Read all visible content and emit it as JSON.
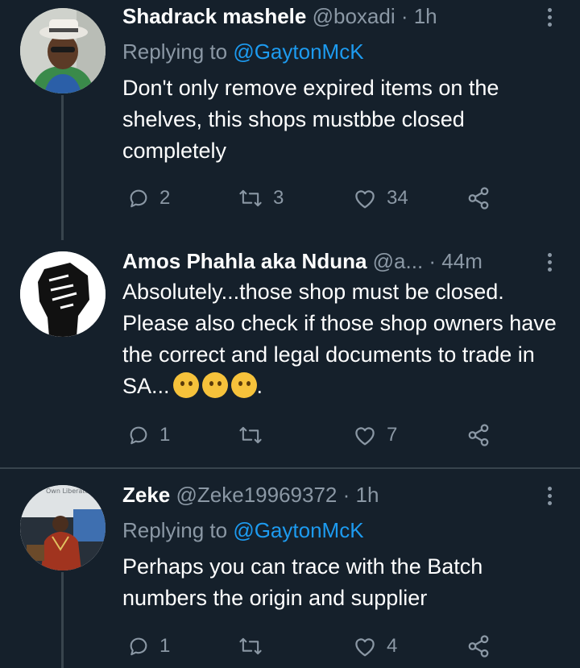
{
  "tweets": [
    {
      "name": "Shadrack mashele",
      "handle": "@boxadi",
      "time": "· 1h",
      "replying_prefix": "Replying to ",
      "replying_to": "@GaytonMcK",
      "text": "Don't only remove expired items on the shelves, this shops mustbbe closed completely",
      "replies": "2",
      "retweets": "3",
      "likes": "34",
      "avatar": "man-with-hat-avatar"
    },
    {
      "name": "Amos Phahla aka Nduna",
      "handle": "@a...",
      "time": "· 44m",
      "text": "Absolutely...those shop must be closed. Please also check if those shop owners have the correct and legal documents to trade in SA...",
      "text_suffix": ".",
      "emojis": [
        "thinking-face",
        "thinking-face",
        "thinking-face"
      ],
      "replies": "1",
      "retweets": "",
      "likes": "7",
      "avatar": "raised-fist-avatar"
    },
    {
      "name": "Zeke",
      "handle": "@Zeke19969372",
      "time": "· 1h",
      "replying_prefix": "Replying to ",
      "replying_to": "@GaytonMcK",
      "text": "Perhaps you can trace with the Batch numbers the origin and supplier",
      "replies": "1",
      "retweets": "",
      "likes": "4",
      "avatar": "speaker-photo-avatar"
    }
  ],
  "avatar_overlay_text": "Own Liberator",
  "colors": {
    "background": "#15202b",
    "text": "#ffffff",
    "secondary": "#8b98a5",
    "link": "#1d9bf0",
    "divider": "#38444d"
  }
}
